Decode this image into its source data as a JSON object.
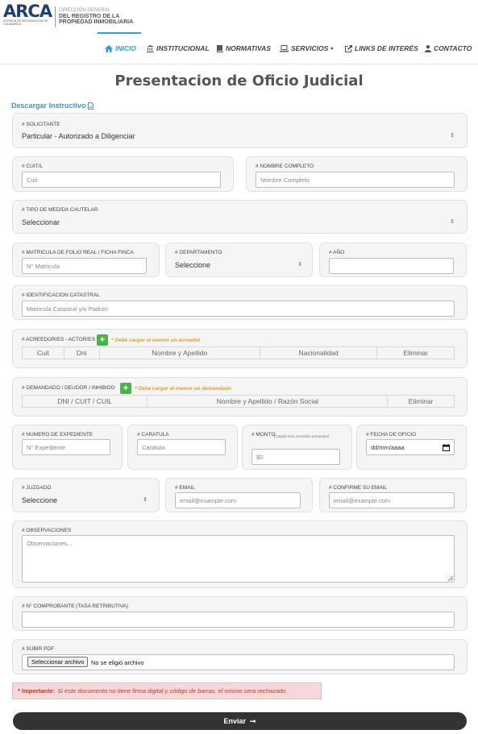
{
  "header": {
    "logo_text": "ARCA",
    "logo_sub": "AGENCIA DE RECAUDACIÓN DE CATAMARCA",
    "dir_line1": "DIRECCIÓN GENERAL",
    "dir_line2": "DEL REGISTRO DE LA",
    "dir_line3": "PROPIEDAD INMOBILIARIA",
    "accent_color": "#2ea0d6"
  },
  "nav": [
    {
      "label": "INICIO",
      "icon": "home-icon"
    },
    {
      "label": "INSTITUCIONAL",
      "icon": "institution-icon"
    },
    {
      "label": "NORMATIVAS",
      "icon": "book-icon"
    },
    {
      "label": "SERVICIOS",
      "icon": "laptop-icon"
    },
    {
      "label": "LINKS DE INTERÉS",
      "icon": "external-link-icon"
    },
    {
      "label": "CONTACTO",
      "icon": "user-icon"
    }
  ],
  "page": {
    "title": "Presentacion de Oficio Judicial",
    "download_label": "Descargar Instructivo"
  },
  "form": {
    "solicitante": {
      "label": "# SOLICITANTE",
      "value": "Particular - Autorizado a Diligenciar"
    },
    "cuit": {
      "label": "# CUIT/L",
      "placeholder": "Cuit"
    },
    "nombre": {
      "label": "# NOMBRE COMPLETO",
      "placeholder": "Nombre Completo"
    },
    "tipo_medida": {
      "label": "# TIPO DE MEDIDA CAUTELAR",
      "value": "Seleccionar"
    },
    "matricula": {
      "label": "# MATRICULA DE FOLIO REAL / FICHA FINCA",
      "placeholder": "N° Matricula"
    },
    "departamento": {
      "label": "# DEPARTAMENTO",
      "value": "Seleccione"
    },
    "anio": {
      "label": "# AÑO",
      "placeholder": ""
    },
    "catastral": {
      "label": "# IDENTIFICACION CATASTRAL",
      "placeholder": "Matricula Catastral y/o Padron"
    },
    "acreedores": {
      "label": "# ACREEDOR/ES - ACTOR/ES",
      "warning": "* Debe cargar al menos un acreedor",
      "columns": [
        "Cuit",
        "Dni",
        "Nombre y Apellido",
        "Nacionalidad",
        "Eliminar"
      ]
    },
    "demandados": {
      "label": "# DEMANDADO / DEUDOR / INHIBIDO",
      "warning": "* Debe cargar al menos un demandado",
      "columns": [
        "DNI / CUIT / CUIL",
        "Nombre y Apellido / Razón Social",
        "Eliminar"
      ]
    },
    "expediente": {
      "label": "# NUMERO DE EXPEDIENTE",
      "placeholder": "N° Expediente"
    },
    "caratula": {
      "label": "# CARATULA",
      "placeholder": "Caratula"
    },
    "monto": {
      "label": "# MONTO",
      "note": "(Capital mas acrecidas presuntas)",
      "placeholder": "$0"
    },
    "fecha": {
      "label": "# FECHA DE OFICIO",
      "placeholder": "dd/mm/aaaa"
    },
    "juzgado": {
      "label": "# JUZGADO",
      "value": "Seleccione"
    },
    "email": {
      "label": "# EMAIL",
      "placeholder": "email@example.com"
    },
    "confirm_email": {
      "label": "# CONFIRME SU EMAIL",
      "placeholder": "email@example.com"
    },
    "observaciones": {
      "label": "# OBSERVACIONES",
      "placeholder": "Observaciones..."
    },
    "comprobante": {
      "label": "# N° COMPROBANTE (TASA RETRIBUTIVA)",
      "placeholder": ""
    },
    "pdf": {
      "label": "# SUBIR PDF",
      "button": "Seleccionar archivo",
      "none": "No se eligió archivo"
    }
  },
  "alert": {
    "strong": "* Importante:",
    "text": "Si este documento no tiene firma digital y código de barras, el mismo sera rechazado."
  },
  "submit": {
    "label": "Enviar",
    "arrow": "➞"
  }
}
